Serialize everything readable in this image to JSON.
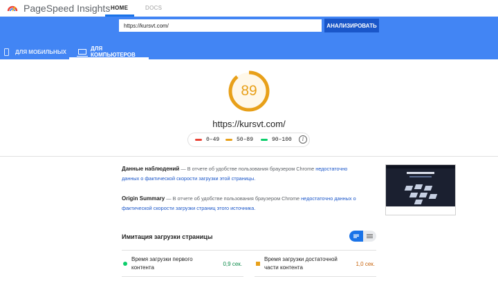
{
  "app": {
    "name": "PageSpeed Insights"
  },
  "nav": {
    "home": "HOME",
    "docs": "DOCS"
  },
  "search": {
    "value": "https://kursvt.com/",
    "button": "АНАЛИЗИРОВАТЬ"
  },
  "devices": {
    "mobile": "ДЛЯ МОБИЛЬНЫХ",
    "desktop": "ДЛЯ КОМПЬЮТЕРОВ",
    "selected": "desktop"
  },
  "score": {
    "value": "89",
    "fraction": 0.89,
    "color": "#e8a019",
    "url": "https://kursvt.com/"
  },
  "legend": {
    "fail": {
      "label": "0–49",
      "color": "#ea4335"
    },
    "average": {
      "label": "50–89",
      "color": "#e8a019"
    },
    "pass": {
      "label": "90–100",
      "color": "#0cce6b"
    },
    "info": "i"
  },
  "field_data": {
    "title": "Данные наблюдений",
    "text": " — В отчете об удобстве пользования браузером Chrome ",
    "link": "недостаточно данных о фактической скорости загрузки этой страницы."
  },
  "origin_summary": {
    "title": "Origin Summary",
    "text": " — В отчете об удобстве пользования браузером Chrome ",
    "link": "недостаточно данных о фактической скорости загрузки страниц этого источника."
  },
  "lab": {
    "title": "Имитация загрузки страницы",
    "metrics": [
      {
        "name": "Время загрузки первого контента",
        "value": "0,9 сек.",
        "status": "pass",
        "color": "#0cce6b"
      },
      {
        "name": "Время загрузки достаточной части контента",
        "value": "1,0 сек.",
        "status": "average",
        "color": "#e8a019"
      }
    ]
  }
}
